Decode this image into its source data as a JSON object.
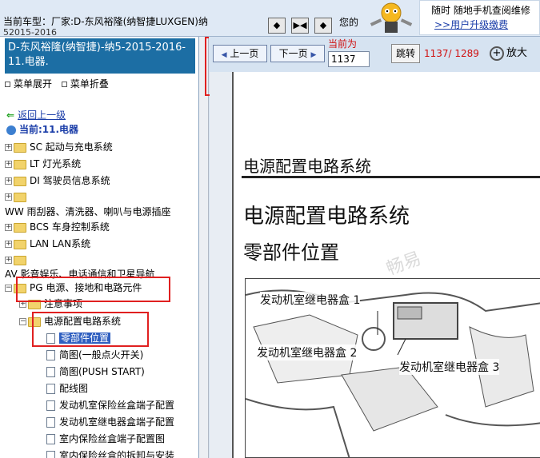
{
  "header": {
    "vehicle_label": "当前车型：",
    "vehicle_value": "厂家:D-东风裕隆(纳智捷LUXGEN)纳",
    "vehicle_value_2": "52015-2016",
    "nav_buttons": [
      "◆",
      "▶◀",
      "◆"
    ],
    "snippet_text": "您的",
    "ad_line1": "随时 随地手机查阅维修",
    "ad_line2": ">>用户升级缴费"
  },
  "sidebar": {
    "title": "D-东风裕隆(纳智捷)-纳5-2015-2016- 11.电器.",
    "expand_all": "菜单展开",
    "collapse_all": "菜单折叠",
    "back_link": "返回上一级",
    "current_label": "当前:11.电器",
    "items": [
      {
        "label": "SC 起动与充电系统"
      },
      {
        "label": "LT 灯光系统"
      },
      {
        "label": "DI 驾驶员信息系统"
      },
      {
        "label": ""
      },
      {
        "label": "WW 雨刮器、清洗器、喇叭与电源插座"
      },
      {
        "label": "BCS 车身控制系统"
      },
      {
        "label": "LAN LAN系统"
      },
      {
        "label": ""
      },
      {
        "label": "AV 影音娱乐、电话通信和卫星导航"
      },
      {
        "label": "PG 电源、接地和电路元件"
      },
      {
        "label": "注意事项"
      },
      {
        "label": "电源配置电路系统"
      },
      {
        "label": "零部件位置"
      },
      {
        "label": "简图(一般点火开关)"
      },
      {
        "label": "简图(PUSH START)"
      },
      {
        "label": "配线图"
      },
      {
        "label": "发动机室保险丝盒端子配置"
      },
      {
        "label": "发动机室继电器盒端子配置"
      },
      {
        "label": "室内保险丝盒端子配置图"
      },
      {
        "label": "室内保险丝盒的拆卸与安装"
      }
    ]
  },
  "toolbar": {
    "prev_label": "上一页",
    "next_label": "下一页",
    "current_label": "当前为",
    "page_value": "1137",
    "jump_label": "跳转",
    "page_count": "1137/ 1289",
    "zoom_label": "放大"
  },
  "document": {
    "section_title": "电源配置电路系统",
    "title": "电源配置电路系统",
    "subtitle": "零部件位置",
    "callouts": [
      "发动机室继电器盒 1",
      "发动机室继电器盒 2",
      "发动机室继电器盒 3"
    ],
    "watermark": "畅易"
  },
  "colors": {
    "highlight_red": "#e02020",
    "header_blue": "#1c6ea4",
    "selected_blue": "#2f5fc0",
    "page_count_red": "#d01010"
  }
}
